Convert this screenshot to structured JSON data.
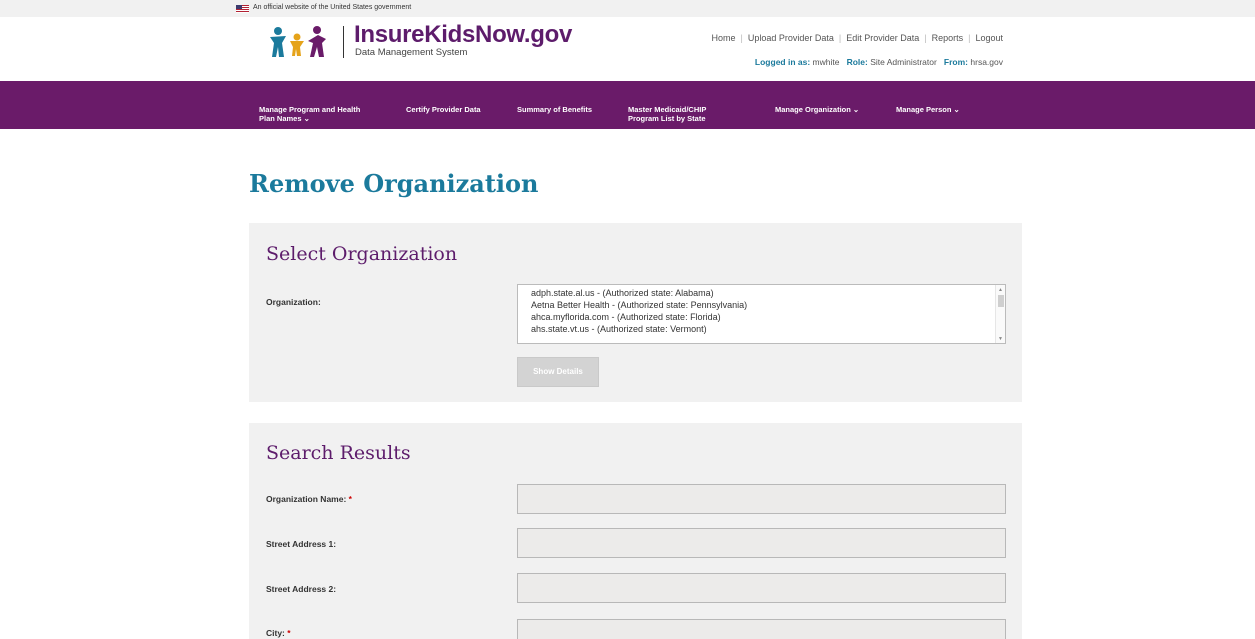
{
  "banner": {
    "text": "An official website of the United States government"
  },
  "brand": {
    "title": "InsureKidsNow.gov",
    "subtitle": "Data Management System"
  },
  "utility_nav": [
    "Home",
    "Upload Provider Data",
    "Edit Provider Data",
    "Reports",
    "Logout"
  ],
  "login": {
    "logged_in_label": "Logged in as:",
    "user": "mwhite",
    "role_label": "Role:",
    "role": "Site Administrator",
    "from_label": "From:",
    "from": "hrsa.gov"
  },
  "main_nav": [
    {
      "line1": "Manage Program and Health",
      "line2": "Plan Names ⌄"
    },
    {
      "line1": "Certify Provider Data",
      "line2": ""
    },
    {
      "line1": "Summary of Benefits",
      "line2": ""
    },
    {
      "line1": "Master Medicaid/CHIP",
      "line2": "Program List by State"
    },
    {
      "line1": "Manage Organization ⌄",
      "line2": ""
    },
    {
      "line1": "Manage Person ⌄",
      "line2": ""
    }
  ],
  "page_title": "Remove Organization",
  "select_panel": {
    "heading": "Select Organization",
    "organization_label": "Organization:",
    "options": [
      "adph.state.al.us - (Authorized state: Alabama)",
      "Aetna Better Health - (Authorized state: Pennsylvania)",
      "ahca.myflorida.com - (Authorized state: Florida)",
      "ahs.state.vt.us - (Authorized state: Vermont)"
    ],
    "show_details_label": "Show Details"
  },
  "results_panel": {
    "heading": "Search Results",
    "fields": [
      {
        "label": "Organization Name:",
        "required": "*"
      },
      {
        "label": "Street Address 1:",
        "required": ""
      },
      {
        "label": "Street Address 2:",
        "required": ""
      },
      {
        "label": "City:",
        "required": "*"
      }
    ]
  },
  "colors": {
    "nav_purple": "#6a1b69",
    "heading_teal": "#1b7a9c",
    "heading_purple": "#5d1c6b",
    "panel_gray": "#f1f1f1"
  }
}
